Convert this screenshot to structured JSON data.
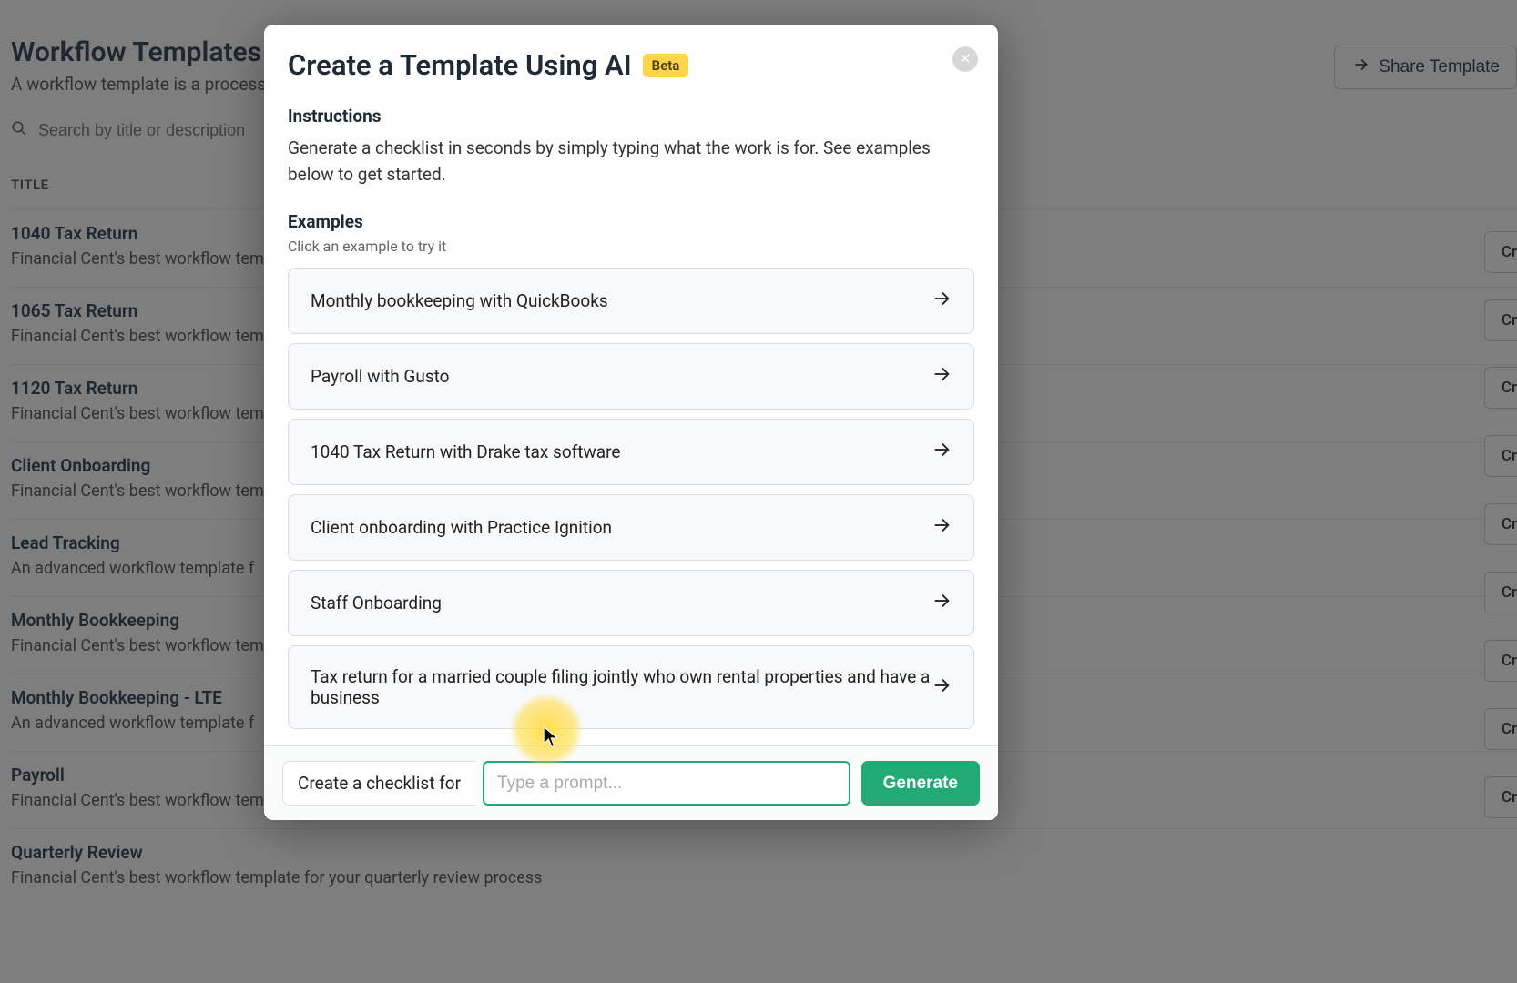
{
  "page": {
    "title": "Workflow Templates",
    "subtitle": "A workflow template is a process of",
    "search_placeholder": "Search by title or description",
    "list_header": "TITLE",
    "share_label": "Share Template",
    "create_pill_label": "Cr",
    "items": [
      {
        "title": "1040 Tax Return",
        "desc": "Financial Cent's best workflow tem"
      },
      {
        "title": "1065 Tax Return",
        "desc": "Financial Cent's best workflow tem"
      },
      {
        "title": "1120 Tax Return",
        "desc": "Financial Cent's best workflow tem"
      },
      {
        "title": "Client Onboarding",
        "desc": "Financial Cent's best workflow tem"
      },
      {
        "title": "Lead Tracking",
        "desc": "An advanced workflow template f"
      },
      {
        "title": "Monthly Bookkeeping",
        "desc": "Financial Cent's best workflow tem"
      },
      {
        "title": "Monthly Bookkeeping - LTE",
        "desc": "An advanced workflow template f"
      },
      {
        "title": "Payroll",
        "desc": "Financial Cent's best workflow tem"
      },
      {
        "title": "Quarterly Review",
        "desc": "Financial Cent's best workflow template for your quarterly review process"
      }
    ],
    "create_pill_positions": [
      254,
      329,
      403,
      478,
      553,
      628,
      703,
      778,
      853
    ]
  },
  "modal": {
    "title": "Create a Template Using AI",
    "beta_label": "Beta",
    "instructions_heading": "Instructions",
    "instructions_text": "Generate a checklist in seconds by simply typing what the work is for. See examples below to get started.",
    "examples_heading": "Examples",
    "examples_sub": "Click an example to try it",
    "examples": [
      "Monthly bookkeeping with QuickBooks",
      "Payroll with Gusto",
      "1040 Tax Return with Drake tax software",
      "Client onboarding with Practice Ignition",
      "Staff Onboarding",
      "Tax return for a married couple filing jointly who own rental properties and have a business"
    ],
    "prefix_label": "Create a checklist for",
    "prompt_placeholder": "Type a prompt...",
    "generate_label": "Generate"
  }
}
